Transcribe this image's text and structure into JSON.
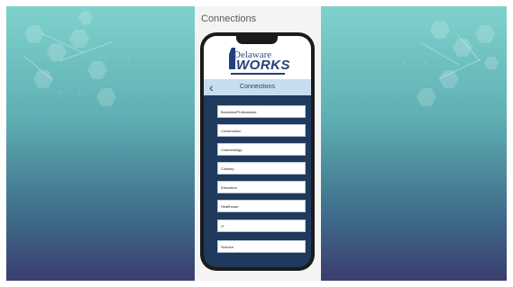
{
  "slide": {
    "panel_title": "Connections"
  },
  "app": {
    "logo_line1": "Delaware",
    "logo_line2": "WORKS",
    "header_title": "Connections",
    "back_symbol": "‹",
    "items": [
      {
        "label": "Business/Professional"
      },
      {
        "label": "Construction"
      },
      {
        "label": "Cosmetology"
      },
      {
        "label": "Culinary"
      },
      {
        "label": "Education"
      },
      {
        "label": "Healthcare"
      },
      {
        "label": "IT"
      },
      {
        "label": "Science"
      }
    ]
  },
  "colors": {
    "screen_bg": "#1f3a5c",
    "header_bg": "#c9ddf0",
    "logo_blue": "#23407a"
  },
  "icons": {
    "back": "chevron-left-icon",
    "logo": "delaware-state-icon"
  }
}
